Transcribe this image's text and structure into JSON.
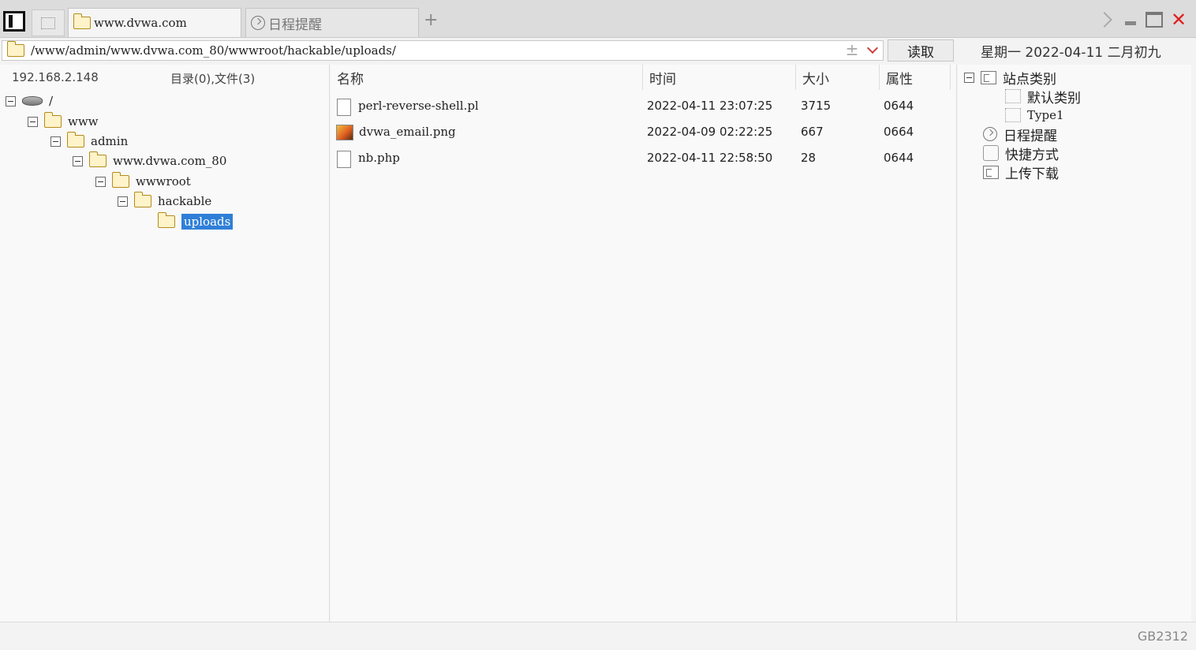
{
  "tabs": [
    {
      "label": "www.dvwa.com",
      "icon": "folder-icon",
      "active": true
    },
    {
      "label": "日程提醒",
      "icon": "clock-icon",
      "active": false
    }
  ],
  "address": {
    "path": "/www/admin/www.dvwa.com_80/wwwroot/hackable/uploads/"
  },
  "read_button": "读取",
  "date_info": "星期一 2022-04-11 二月初九",
  "left_panel": {
    "ip": "192.168.2.148",
    "counts": "目录(0),文件(3)",
    "tree": [
      {
        "label": "/",
        "icon": "drive-icon",
        "level": 0,
        "selected": false
      },
      {
        "label": "www",
        "icon": "folder-icon",
        "level": 1,
        "selected": false
      },
      {
        "label": "admin",
        "icon": "folder-icon",
        "level": 2,
        "selected": false
      },
      {
        "label": "www.dvwa.com_80",
        "icon": "folder-icon",
        "level": 3,
        "selected": false
      },
      {
        "label": "wwwroot",
        "icon": "folder-icon",
        "level": 4,
        "selected": false
      },
      {
        "label": "hackable",
        "icon": "folder-icon",
        "level": 5,
        "selected": false
      },
      {
        "label": "uploads",
        "icon": "folder-icon",
        "level": 6,
        "selected": true
      }
    ]
  },
  "file_list": {
    "columns": [
      "名称",
      "时间",
      "大小",
      "属性"
    ],
    "rows": [
      {
        "name": "perl-reverse-shell.pl",
        "time": "2022-04-11 23:07:25",
        "size": "3715",
        "attr": "0644",
        "icon": "file-icon"
      },
      {
        "name": "dvwa_email.png",
        "time": "2022-04-09 02:22:25",
        "size": "667",
        "attr": "0664",
        "icon": "image-icon"
      },
      {
        "name": "nb.php",
        "time": "2022-04-11 22:58:50",
        "size": "28",
        "attr": "0644",
        "icon": "file-icon"
      }
    ]
  },
  "right_panel": {
    "items": [
      {
        "label": "站点类别",
        "icon": "category-icon",
        "level": 0,
        "toggle": true
      },
      {
        "label": "默认类别",
        "icon": "dotted-box-icon",
        "level": 1,
        "toggle": false
      },
      {
        "label": "Type1",
        "icon": "dotted-box-icon",
        "level": 1,
        "toggle": false
      },
      {
        "label": "日程提醒",
        "icon": "clock-icon",
        "level": 0,
        "toggle": false
      },
      {
        "label": "快捷方式",
        "icon": "hand-icon",
        "level": 0,
        "toggle": false
      },
      {
        "label": "上传下载",
        "icon": "transfer-icon",
        "level": 0,
        "toggle": false
      }
    ]
  },
  "status": {
    "encoding": "GB2312"
  },
  "colors": {
    "selection": "#2f7fd8",
    "close": "#e02020",
    "folder": "#b58b1a"
  }
}
